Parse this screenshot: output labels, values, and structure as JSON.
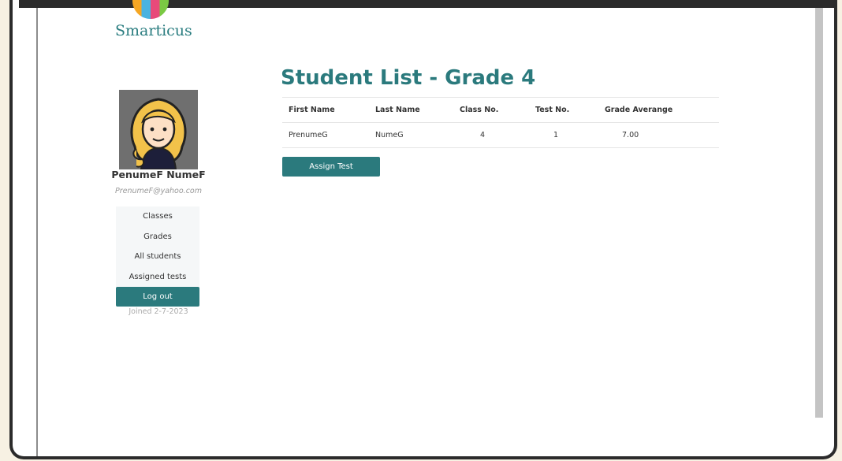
{
  "brand": {
    "name": "Smarticus"
  },
  "profile": {
    "name": "PenumeF NumeF",
    "email": "PrenumeF@yahoo.com",
    "joined": "Joined 2-7-2023"
  },
  "sidebar": {
    "items": [
      {
        "label": "Classes"
      },
      {
        "label": "Grades"
      },
      {
        "label": "All students"
      },
      {
        "label": "Assigned tests"
      }
    ],
    "logout_label": "Log out"
  },
  "main": {
    "title": "Student List - Grade 4",
    "table": {
      "columns": [
        "First Name",
        "Last Name",
        "Class No.",
        "Test No.",
        "Grade Averange"
      ],
      "rows": [
        {
          "first_name": "PrenumeG",
          "last_name": "NumeG",
          "class_no": "4",
          "test_no": "1",
          "grade_average": "7.00"
        }
      ]
    },
    "assign_button_label": "Assign Test"
  },
  "colors": {
    "accent": "#2b7a7d",
    "logo_text": "#2a7d80"
  }
}
